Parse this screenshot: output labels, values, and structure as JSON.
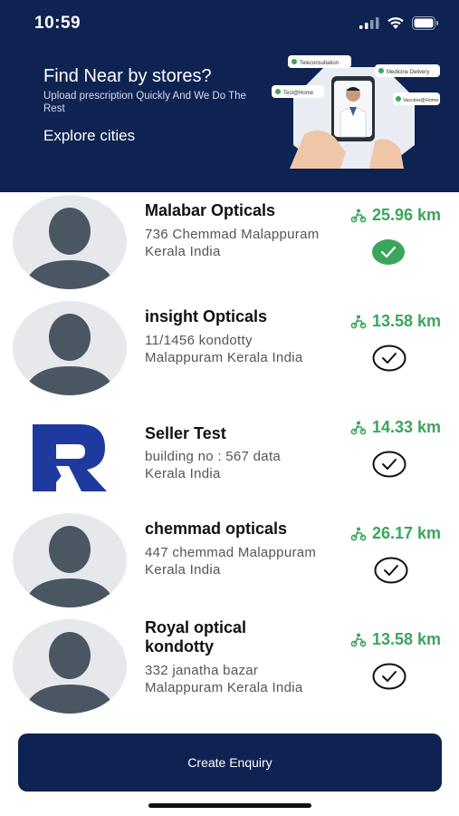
{
  "status": {
    "time": "10:59"
  },
  "hero": {
    "title": "Find Near by stores?",
    "subtitle": "Upload prescription Quickly And We Do The Rest",
    "link": "Explore cities",
    "chips": [
      "Teleconsultation",
      "Medicine Delivery",
      "Test@Home",
      "Vaccine@Home"
    ]
  },
  "stores": [
    {
      "name": "Malabar Opticals",
      "address": "736 Chemmad Malappuram Kerala India",
      "distance": "25.96 km",
      "selected": true,
      "image": "avatar-placeholder"
    },
    {
      "name": "insight Opticals",
      "address": "11/1456 kondotty Malappuram Kerala India",
      "distance": "13.58 km",
      "selected": false,
      "image": "avatar-placeholder"
    },
    {
      "name": "Seller Test",
      "address": "building no : 567 data Kerala India",
      "distance": "14.33 km",
      "selected": false,
      "image": "brand-logo"
    },
    {
      "name": "chemmad opticals",
      "address": "447 chemmad Malappuram Kerala India",
      "distance": "26.17 km",
      "selected": false,
      "image": "avatar-placeholder"
    },
    {
      "name": "Royal optical kondotty",
      "address": "332 janatha bazar Malappuram Kerala India",
      "distance": "13.58 km",
      "selected": false,
      "image": "avatar-placeholder"
    }
  ],
  "cta": {
    "label": "Create Enquiry"
  },
  "colors": {
    "brand_navy": "#0f2352",
    "accent_green": "#3ba55c",
    "avatar_bg": "#e6e8eb",
    "avatar_fg": "#4a5661",
    "logo_blue": "#1e3a9e"
  },
  "icons": {
    "distance": "delivery-scooter-icon",
    "select": "check-circle-icon",
    "selected": "check-circle-filled-icon"
  }
}
